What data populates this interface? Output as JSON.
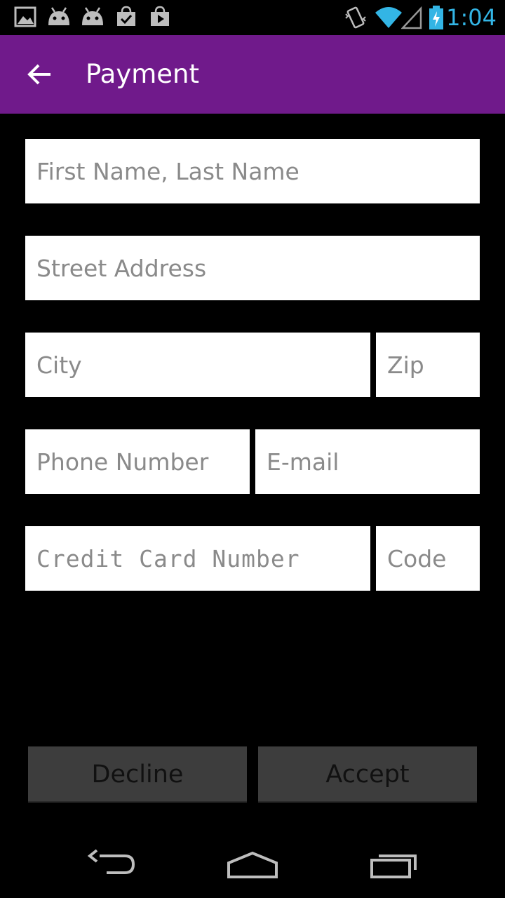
{
  "status_bar": {
    "time": "1:04",
    "left_icons": [
      "gallery-icon",
      "android-icon",
      "android-icon",
      "store-check-icon",
      "store-play-icon"
    ],
    "right_icons": [
      "vibrate-icon",
      "wifi-icon",
      "signal-icon",
      "battery-charging-icon"
    ],
    "time_color": "#33b5e5"
  },
  "action_bar": {
    "title": "Payment",
    "back_icon": "arrow-back-icon",
    "background": "#701a8b"
  },
  "form": {
    "name": {
      "placeholder": "First Name, Last Name",
      "value": ""
    },
    "street": {
      "placeholder": "Street Address",
      "value": ""
    },
    "city": {
      "placeholder": "City",
      "value": ""
    },
    "zip": {
      "placeholder": "Zip",
      "value": ""
    },
    "phone": {
      "placeholder": "Phone Number",
      "value": ""
    },
    "email": {
      "placeholder": "E-mail",
      "value": ""
    },
    "card_number": {
      "placeholder": "Credit Card Number",
      "value": ""
    },
    "code": {
      "placeholder": "Code",
      "value": ""
    }
  },
  "buttons": {
    "decline": "Decline",
    "accept": "Accept"
  },
  "nav_bar": {
    "items": [
      "back-nav-icon",
      "home-nav-icon",
      "recents-nav-icon"
    ]
  }
}
